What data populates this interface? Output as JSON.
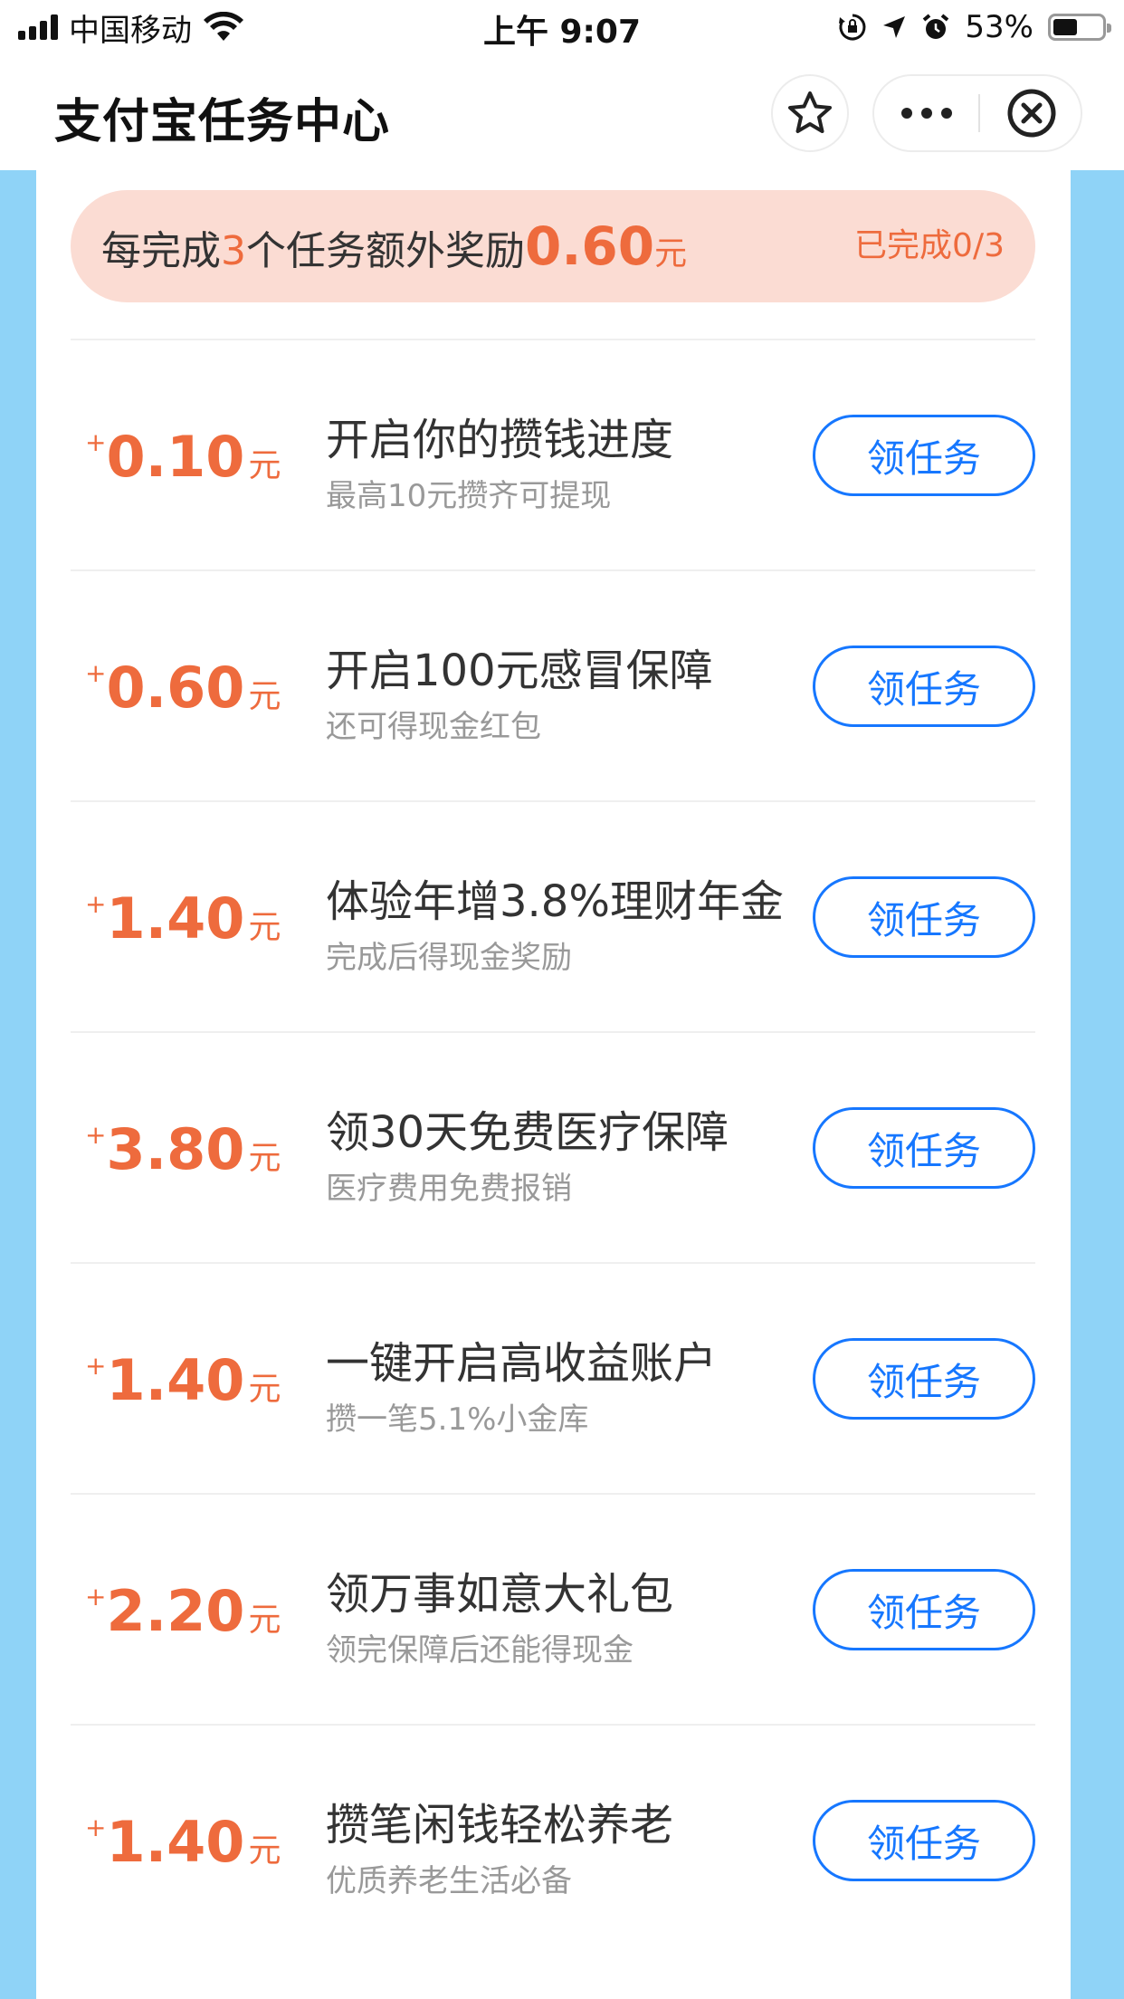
{
  "status_bar": {
    "carrier": "中国移动",
    "time": "上午 9:07",
    "battery": "53%",
    "battery_level": 0.53
  },
  "nav": {
    "title": "支付宝任务中心"
  },
  "banner": {
    "prefix": "每完成",
    "count": "3",
    "middle": "个任务额外奖励",
    "amount": "0.60",
    "unit": "元",
    "status": "已完成0/3"
  },
  "tasks": [
    {
      "plus": "+",
      "amount": "0.10",
      "unit": "元",
      "title": "开启你的攒钱进度",
      "subtitle": "最高10元攒齐可提现",
      "button": "领任务"
    },
    {
      "plus": "+",
      "amount": "0.60",
      "unit": "元",
      "title": "开启100元感冒保障",
      "subtitle": "还可得现金红包",
      "button": "领任务"
    },
    {
      "plus": "+",
      "amount": "1.40",
      "unit": "元",
      "title": "体验年增3.8%理财年金",
      "subtitle": "完成后得现金奖励",
      "button": "领任务"
    },
    {
      "plus": "+",
      "amount": "3.80",
      "unit": "元",
      "title": "领30天免费医疗保障",
      "subtitle": "医疗费用免费报销",
      "button": "领任务"
    },
    {
      "plus": "+",
      "amount": "1.40",
      "unit": "元",
      "title": "一键开启高收益账户",
      "subtitle": "攒一笔5.1%小金库",
      "button": "领任务"
    },
    {
      "plus": "+",
      "amount": "2.20",
      "unit": "元",
      "title": "领万事如意大礼包",
      "subtitle": "领完保障后还能得现金",
      "button": "领任务"
    },
    {
      "plus": "+",
      "amount": "1.40",
      "unit": "元",
      "title": "攒笔闲钱轻松养老",
      "subtitle": "优质养老生活必备",
      "button": "领任务"
    }
  ],
  "icons": {
    "star": "star-icon",
    "more": "more-icon",
    "close": "close-circle-icon",
    "wifi": "wifi-icon",
    "signal": "signal-icon",
    "lock": "orientation-lock-icon",
    "location": "location-arrow-icon",
    "alarm": "alarm-icon",
    "battery": "battery-icon"
  },
  "colors": {
    "accent": "#ee6b3d",
    "button": "#1677ff",
    "banner_bg": "#fbdcd3",
    "side": "#8fd3f7"
  }
}
